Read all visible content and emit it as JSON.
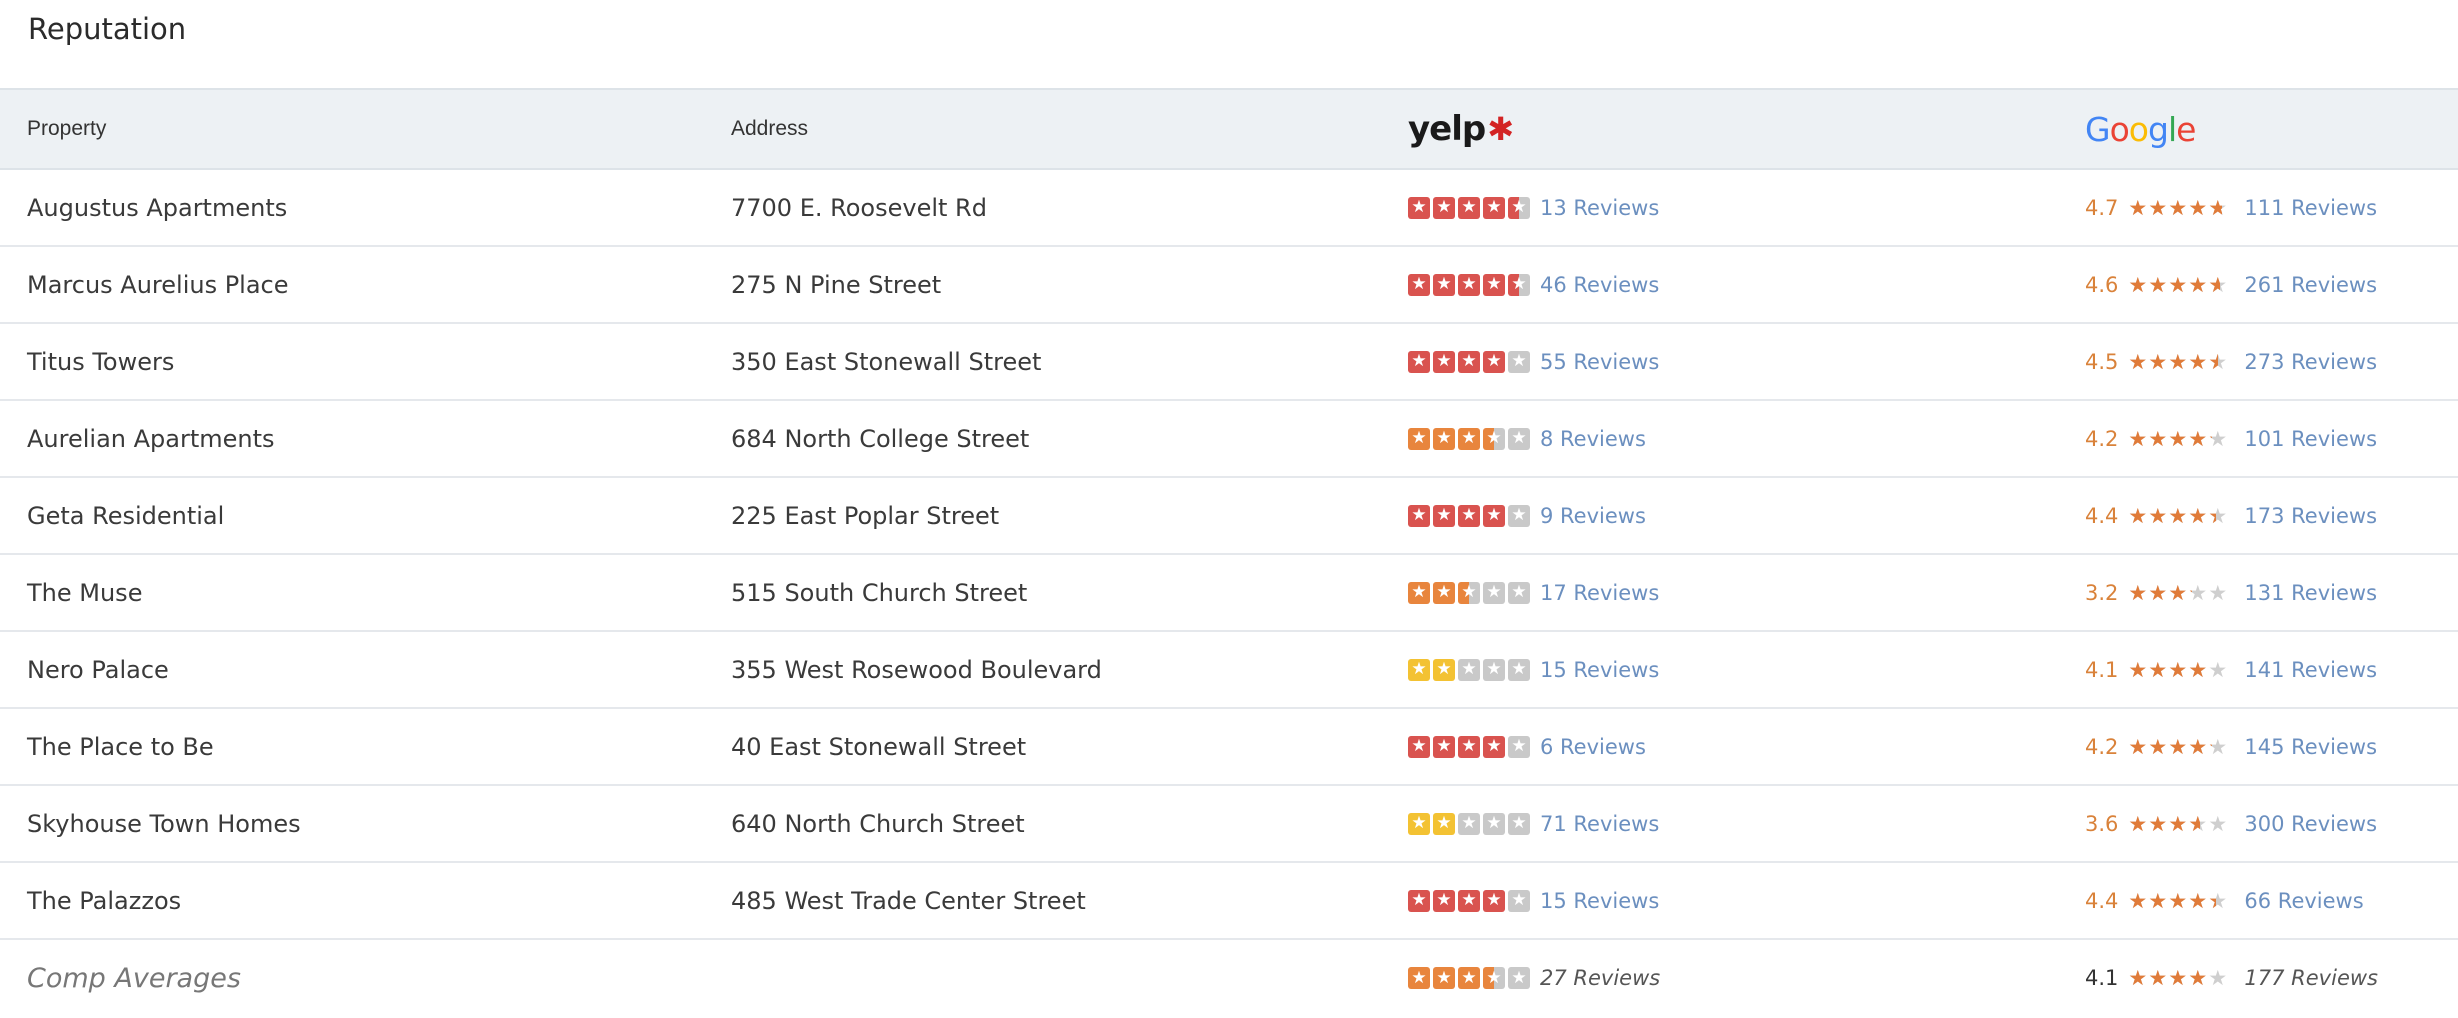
{
  "page": {
    "title": "Reputation"
  },
  "columns": {
    "property": "Property",
    "address": "Address",
    "yelp_logo": "yelp",
    "google_logo": "Google"
  },
  "colors": {
    "yelp_red": "#d9534f",
    "yelp_orange": "#e8853d",
    "yelp_yellow": "#f3c233",
    "yelp_empty": "#c9c9c9",
    "google_star": "#e07b39",
    "link": "#6b8fbf"
  },
  "rows": [
    {
      "property": "Augustus Apartments",
      "address": "7700 E. Roosevelt Rd",
      "yelp_rating": 4.5,
      "yelp_reviews": "13 Reviews",
      "google_score": "4.7",
      "google_rating": 4.7,
      "google_reviews": "111 Reviews"
    },
    {
      "property": "Marcus Aurelius Place",
      "address": "275 N Pine Street",
      "yelp_rating": 4.5,
      "yelp_reviews": "46 Reviews",
      "google_score": "4.6",
      "google_rating": 4.6,
      "google_reviews": "261 Reviews"
    },
    {
      "property": "Titus Towers",
      "address": "350 East Stonewall Street",
      "yelp_rating": 4,
      "yelp_reviews": "55 Reviews",
      "google_score": "4.5",
      "google_rating": 4.5,
      "google_reviews": "273 Reviews"
    },
    {
      "property": "Aurelian Apartments",
      "address": "684 North College Street",
      "yelp_rating": 3.5,
      "yelp_reviews": "8 Reviews",
      "google_score": "4.2",
      "google_rating": 4.2,
      "google_reviews": "101 Reviews"
    },
    {
      "property": "Geta Residential",
      "address": "225 East Poplar Street",
      "yelp_rating": 4,
      "yelp_reviews": "9 Reviews",
      "google_score": "4.4",
      "google_rating": 4.4,
      "google_reviews": "173 Reviews"
    },
    {
      "property": "The Muse",
      "address": "515 South Church Street",
      "yelp_rating": 2.5,
      "yelp_reviews": "17 Reviews",
      "google_score": "3.2",
      "google_rating": 3.2,
      "google_reviews": "131 Reviews"
    },
    {
      "property": "Nero Palace",
      "address": "355 West Rosewood Boulevard",
      "yelp_rating": 2,
      "yelp_reviews": "15 Reviews",
      "google_score": "4.1",
      "google_rating": 4.1,
      "google_reviews": "141 Reviews"
    },
    {
      "property": "The Place to Be",
      "address": "40 East Stonewall Street",
      "yelp_rating": 4,
      "yelp_reviews": "6 Reviews",
      "google_score": "4.2",
      "google_rating": 4.2,
      "google_reviews": "145 Reviews"
    },
    {
      "property": "Skyhouse Town Homes",
      "address": "640 North Church Street",
      "yelp_rating": 2,
      "yelp_reviews": "71 Reviews",
      "google_score": "3.6",
      "google_rating": 3.6,
      "google_reviews": "300 Reviews"
    },
    {
      "property": "The Palazzos",
      "address": "485 West Trade Center Street",
      "yelp_rating": 4,
      "yelp_reviews": "15 Reviews",
      "google_score": "4.4",
      "google_rating": 4.4,
      "google_reviews": "66 Reviews"
    }
  ],
  "comp": {
    "label": "Comp Averages",
    "yelp_rating": 3.5,
    "yelp_reviews": "27 Reviews",
    "google_score": "4.1",
    "google_rating": 4.1,
    "google_reviews": "177 Reviews"
  }
}
